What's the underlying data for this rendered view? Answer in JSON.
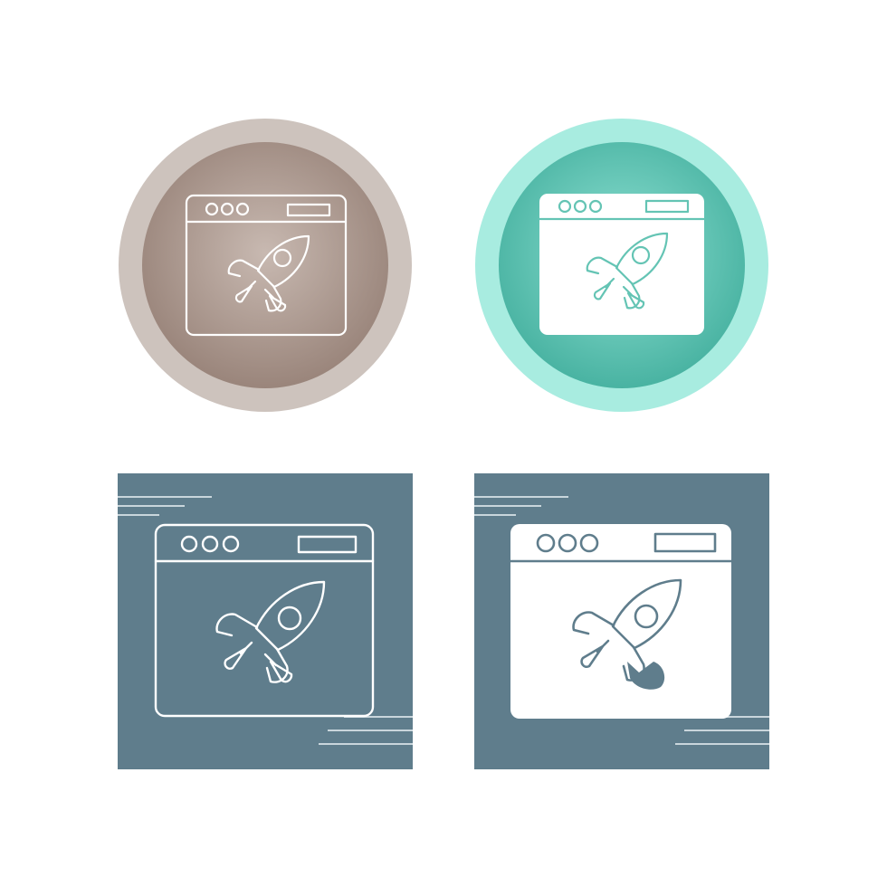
{
  "icons": [
    {
      "variant": "circle-outline",
      "icon": "browser-rocket-icon",
      "colors": {
        "ring": "#cdc3bd",
        "inner_center": "#c8b9b1",
        "inner_edge": "#9a857b",
        "stroke": "#ffffff"
      }
    },
    {
      "variant": "circle-filled",
      "icon": "browser-rocket-icon",
      "colors": {
        "ring": "#a8ece0",
        "inner_center": "#8ee0d2",
        "inner_edge": "#49b3a2",
        "fill": "#ffffff",
        "stroke": "#64c4b4"
      }
    },
    {
      "variant": "square-outline",
      "icon": "browser-rocket-icon",
      "colors": {
        "background": "#5f7d8c",
        "stroke": "#ffffff",
        "speed_lines": "#c9d6dc"
      }
    },
    {
      "variant": "square-glyph",
      "icon": "browser-rocket-icon",
      "colors": {
        "background": "#5f7d8c",
        "fill": "#ffffff",
        "stroke": "#5f7d8c",
        "speed_lines": "#c9d6dc"
      }
    }
  ]
}
